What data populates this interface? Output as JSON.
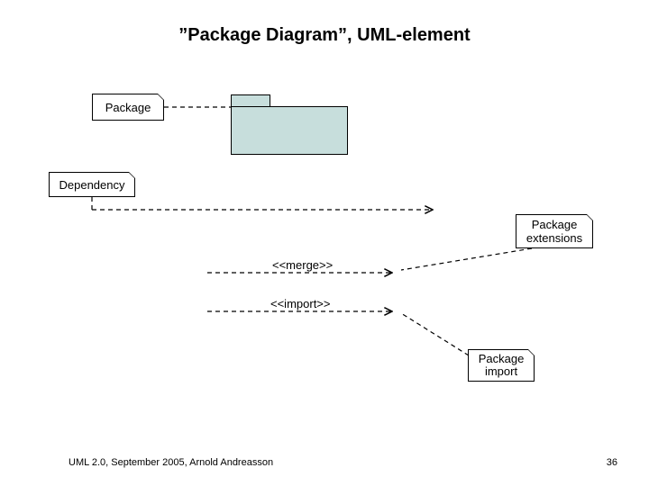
{
  "title": "”Package Diagram”, UML-element",
  "labels": {
    "package": "Package",
    "dependency": "Dependency",
    "package_extensions_line1": "Package",
    "package_extensions_line2": "extensions",
    "package_import_line1": "Package",
    "package_import_line2": "import",
    "merge": "<<merge>>",
    "import": "<<import>>"
  },
  "footer": {
    "left": "UML 2.0, September 2005, Arnold Andreasson",
    "right": "36"
  },
  "colors": {
    "package_fill": "#c7dedc",
    "line": "#000000",
    "background": "#ffffff"
  }
}
